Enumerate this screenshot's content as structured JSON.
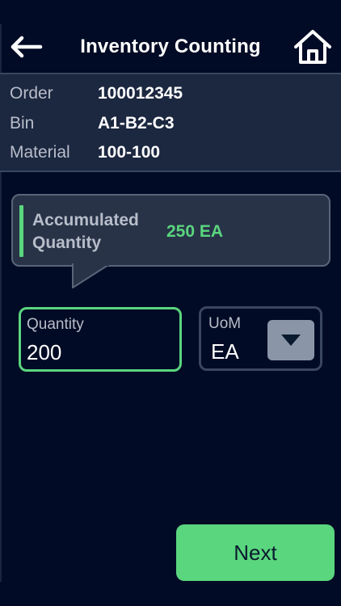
{
  "header": {
    "title": "Inventory Counting",
    "back_icon": "arrow-left-icon",
    "home_icon": "home-icon"
  },
  "info": {
    "rows": [
      {
        "label": "Order",
        "value": "100012345"
      },
      {
        "label": "Bin",
        "value": "A1-B2-C3"
      },
      {
        "label": "Material",
        "value": "100-100"
      }
    ]
  },
  "accumulated": {
    "label": "Accumulated Quantity",
    "value": "250 EA"
  },
  "quantity": {
    "label": "Quantity",
    "value": "200"
  },
  "uom": {
    "label": "UoM",
    "value": "EA",
    "dropdown_icon": "caret-down-icon"
  },
  "footer": {
    "next_label": "Next"
  },
  "colors": {
    "background": "#020b25",
    "panel": "#1c2740",
    "accent": "#5ad67e",
    "muted_text": "#b7bdc9"
  }
}
